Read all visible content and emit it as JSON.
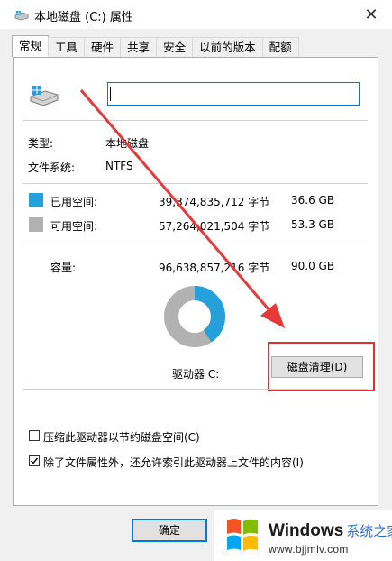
{
  "window": {
    "title": "本地磁盘 (C:) 属性",
    "close_symbol": "✕"
  },
  "tabs": [
    "常规",
    "工具",
    "硬件",
    "共享",
    "安全",
    "以前的版本",
    "配额"
  ],
  "general": {
    "name_value": "",
    "type_label": "类型:",
    "type_value": "本地磁盘",
    "fs_label": "文件系统:",
    "fs_value": "NTFS",
    "used_label": "已用空间:",
    "used_bytes": "39,374,835,712 字节",
    "used_gb": "36.6 GB",
    "free_label": "可用空间:",
    "free_bytes": "57,264,021,504 字节",
    "free_gb": "53.3 GB",
    "cap_label": "容量:",
    "cap_bytes": "96,638,857,216 字节",
    "cap_gb": "90.0 GB",
    "drive_label": "驱动器 C:",
    "cleanup_button": "磁盘清理(D)",
    "compress_label": "压缩此驱动器以节约磁盘空间(C)",
    "compress_checked": false,
    "index_label": "除了文件属性外，还允许索引此驱动器上文件的内容(I)",
    "index_checked": true
  },
  "usage": {
    "used_fraction": 0.407,
    "free_fraction": 0.593
  },
  "colors": {
    "used": "#26a0da",
    "free": "#b2b2b2",
    "highlight": "#e03030"
  },
  "buttons": {
    "ok": "确定"
  },
  "watermark": {
    "brand": "Windows",
    "brand_cn": "系统之家",
    "url": "www.bjjmlv.com"
  }
}
